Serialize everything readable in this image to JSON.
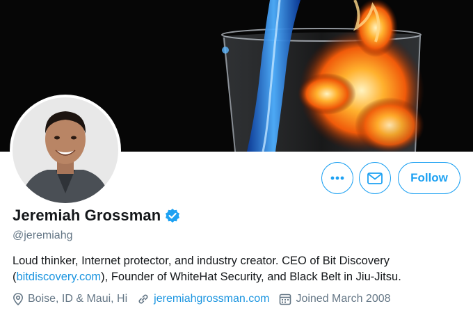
{
  "profile": {
    "display_name": "Jeremiah Grossman",
    "handle": "@jeremiahg",
    "verified": true,
    "bio_text_1": "Loud thinker, Internet protector, and industry creator. CEO of Bit Discovery (",
    "bio_link": "bitdiscovery.com",
    "bio_text_2": "), Founder of WhiteHat Security, and Black Belt in Jiu-Jitsu.",
    "location": "Boise, ID & Maui, Hi",
    "website": "jeremiahgrossman.com",
    "joined": "Joined March 2008"
  },
  "actions": {
    "more_icon": "more-icon",
    "message_icon": "envelope-icon",
    "follow_label": "Follow"
  },
  "icons": {
    "location": "location-pin-icon",
    "website": "link-icon",
    "joined": "calendar-icon",
    "verified": "verified-badge-icon"
  },
  "colors": {
    "accent": "#1da1f2",
    "link": "#1b95e0",
    "secondary_text": "#657786",
    "primary_text": "#14171a"
  }
}
